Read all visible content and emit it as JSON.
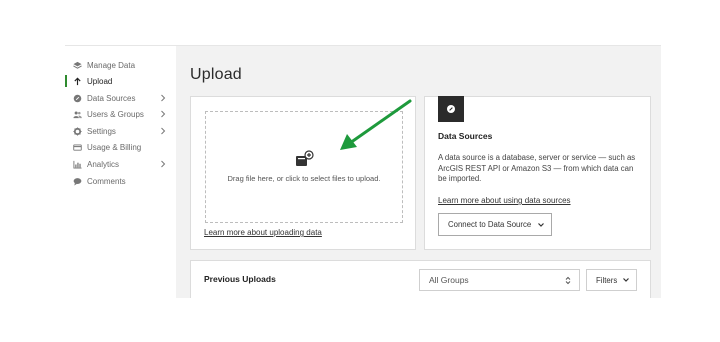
{
  "sidebar": {
    "items": [
      {
        "label": "Manage Data",
        "icon": "layers-icon"
      },
      {
        "label": "Upload",
        "icon": "upload-arrow-icon",
        "active": true
      },
      {
        "label": "Data Sources",
        "icon": "data-source-icon",
        "has_children": true
      },
      {
        "label": "Users & Groups",
        "icon": "users-icon",
        "has_children": true
      },
      {
        "label": "Settings",
        "icon": "gear-icon",
        "has_children": true
      },
      {
        "label": "Usage & Billing",
        "icon": "billing-icon"
      },
      {
        "label": "Analytics",
        "icon": "bar-chart-icon",
        "has_children": true
      },
      {
        "label": "Comments",
        "icon": "comment-icon"
      }
    ]
  },
  "main": {
    "title": "Upload",
    "upload": {
      "dropzone_text": "Drag file here, or click to select files to upload.",
      "learn_link": "Learn more about uploading data"
    },
    "data_sources": {
      "title": "Data Sources",
      "description": "A data source is a database, server or service — such as ArcGIS REST API or Amazon S3 — from which data can be imported.",
      "learn_link": "Learn more about using data sources",
      "connect_button": "Connect to Data Source"
    },
    "previous_uploads": {
      "title": "Previous Uploads",
      "group_select": "All Groups",
      "filters_button": "Filters"
    }
  },
  "colors": {
    "accent": "#2f8b2f",
    "arrow": "#1e9a3c",
    "content_bg": "#f2f2f2"
  }
}
